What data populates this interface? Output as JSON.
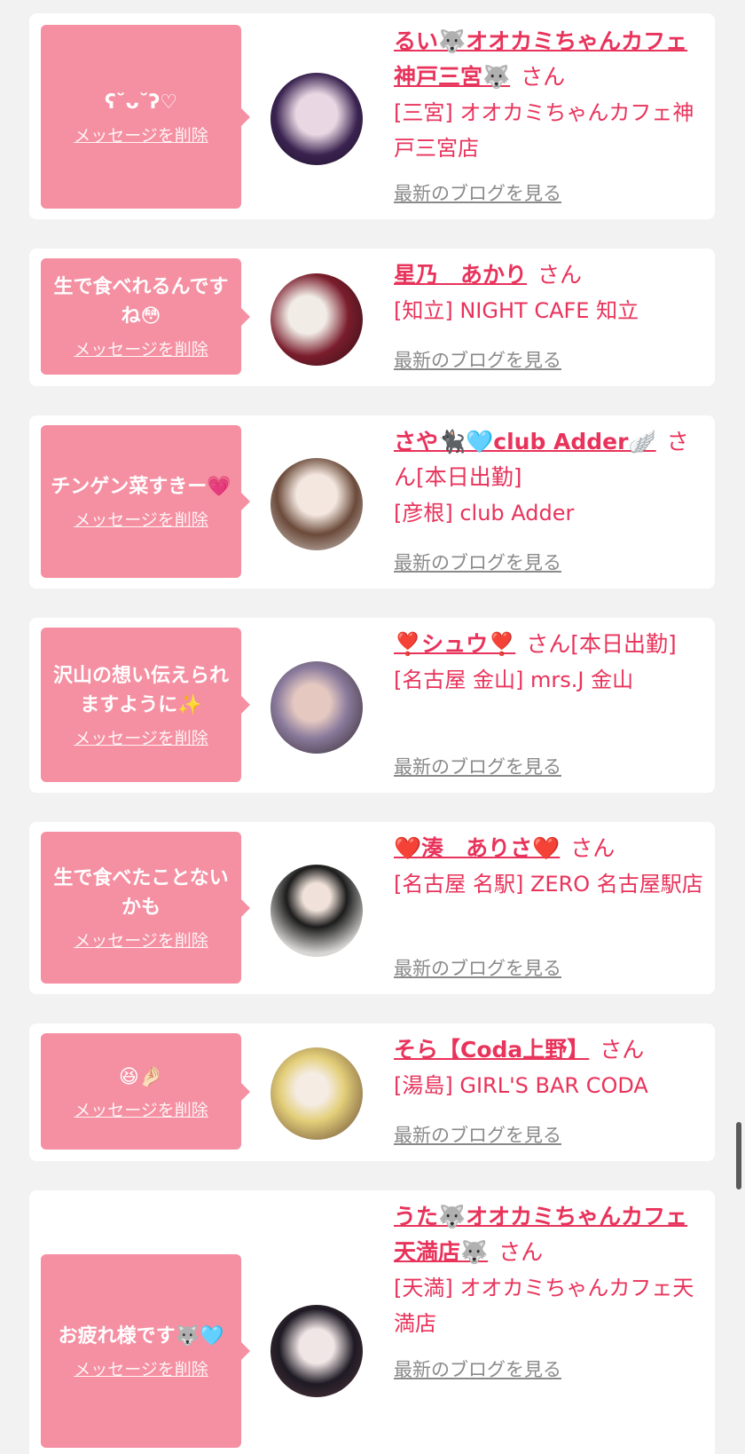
{
  "suffix_san": "さん",
  "delete_label": "メッセージを削除",
  "blog_label": "最新のブログを見る",
  "colors": {
    "accent": "#e8335b",
    "bubble": "#f58fa2",
    "link_gray": "#8a8a8a",
    "background": "#f2f2f2"
  },
  "messages": [
    {
      "message": "ʕ˘ᴗ˘ʔ♡",
      "name": "るい🐺オオカミちゃんカフェ神戸三宮🐺",
      "status": "",
      "shop": "[三宮] オオカミちゃんカフェ神戸三宮店",
      "avatar": "avatar-rui"
    },
    {
      "message": "生で食べれるんですね😳",
      "name": "星乃　あかり",
      "status": "",
      "shop": "[知立] NIGHT CAFE 知立",
      "avatar": "avatar-akari"
    },
    {
      "message": "チンゲン菜すきー💗",
      "name": "さや🐈‍⬛🩵club Adder🪽",
      "status": "[本日出勤]",
      "shop": "[彦根] club Adder",
      "avatar": "avatar-saya"
    },
    {
      "message": "沢山の想い伝えられますように✨",
      "name": "❣️シュウ❣️",
      "status": "[本日出勤]",
      "shop": "[名古屋 金山] mrs.J 金山",
      "avatar": "avatar-shu"
    },
    {
      "message": "生で食べたことないかも",
      "name": "❤️湊　ありさ❤️",
      "status": "",
      "shop": "[名古屋 名駅] ZERO 名古屋駅店",
      "avatar": "avatar-arisa"
    },
    {
      "message": "😆🤌🏻",
      "name": "そら【Coda上野】",
      "status": "",
      "shop": "[湯島] GIRL'S BAR CODA",
      "avatar": "avatar-sora"
    },
    {
      "message": "お疲れ様です🐺🩵",
      "name": "うた🐺オオカミちゃんカフェ天満店🐺",
      "status": "",
      "shop": "[天満] オオカミちゃんカフェ天満店",
      "avatar": "avatar-uta"
    }
  ]
}
